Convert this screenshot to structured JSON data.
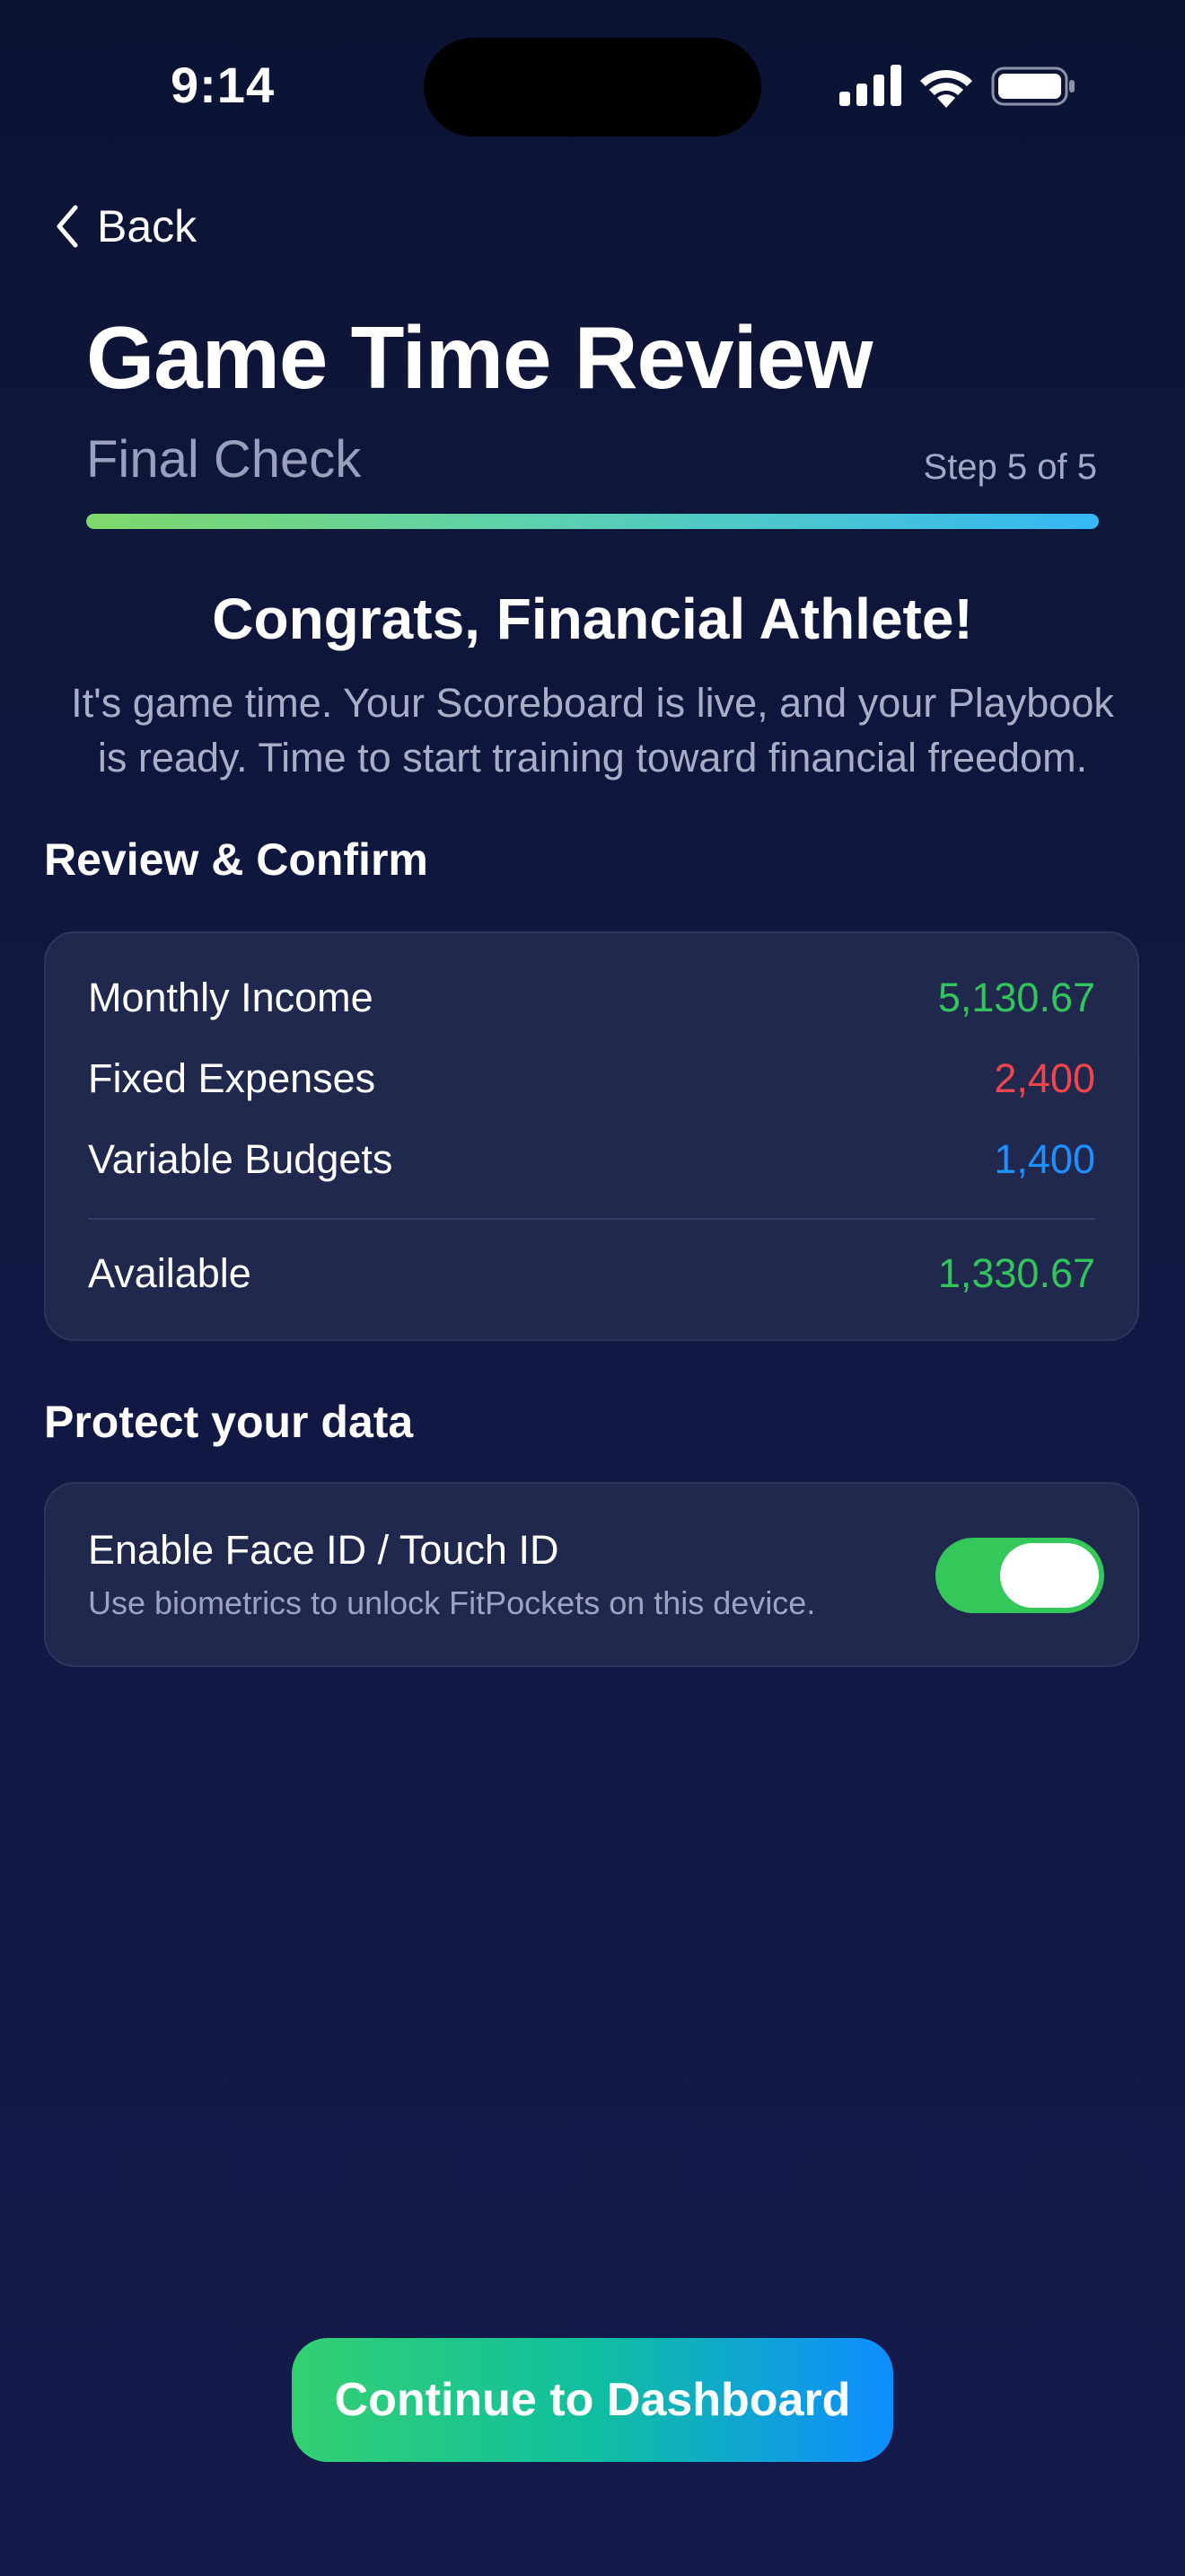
{
  "status_bar": {
    "time": "9:14"
  },
  "nav": {
    "back_label": "Back"
  },
  "header": {
    "title": "Game Time Review",
    "subtitle": "Final Check",
    "step": "Step 5 of 5",
    "progress_fraction": 1.0,
    "progress_colors": [
      "#7fd86a",
      "#35b8f5"
    ]
  },
  "hero": {
    "heading": "Congrats, Financial Athlete!",
    "body_line1": "It's game time. Your Scoreboard is live, and your Playbook",
    "body_line2": "is ready. Time to start training toward financial freedom."
  },
  "review": {
    "section_title": "Review & Confirm",
    "rows": [
      {
        "label": "Monthly Income",
        "value": "5,130.67",
        "color": "#31c65c"
      },
      {
        "label": "Fixed Expenses",
        "value": "2,400",
        "color": "#f0454b"
      },
      {
        "label": "Variable Budgets",
        "value": "1,400",
        "color": "#1e8fff"
      }
    ],
    "total": {
      "label": "Available",
      "value": "1,330.67",
      "color": "#31c65c"
    }
  },
  "protect": {
    "section_title": "Protect your data",
    "toggle_title": "Enable Face ID / Touch ID",
    "toggle_description": "Use biometrics to unlock FitPockets on this device.",
    "toggle_on": true,
    "toggle_color": "#34c759"
  },
  "cta": {
    "label": "Continue to Dashboard"
  }
}
